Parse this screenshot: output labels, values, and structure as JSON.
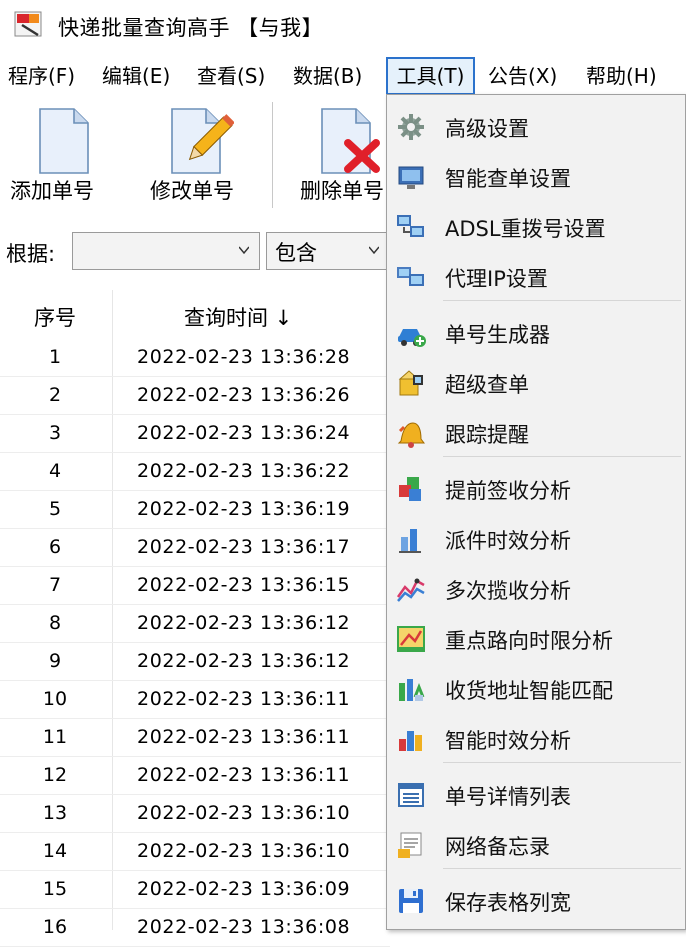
{
  "window": {
    "title": "快递批量查询高手 【与我】"
  },
  "menubar": {
    "items": [
      {
        "label": "程序(F)"
      },
      {
        "label": "编辑(E)"
      },
      {
        "label": "查看(S)"
      },
      {
        "label": "数据(B)"
      },
      {
        "label": "工具(T)"
      },
      {
        "label": "公告(X)"
      },
      {
        "label": "帮助(H)"
      }
    ]
  },
  "toolbar": {
    "add_label": "添加单号",
    "edit_label": "修改单号",
    "delete_label": "删除单号"
  },
  "filter": {
    "label": "根据:",
    "field_value": "",
    "mode_value": "包含"
  },
  "table": {
    "headers": {
      "index": "序号",
      "time": "查询时间 ↓"
    },
    "rows": [
      {
        "num": "1",
        "time": "2022-02-23 13:36:28"
      },
      {
        "num": "2",
        "time": "2022-02-23 13:36:26"
      },
      {
        "num": "3",
        "time": "2022-02-23 13:36:24"
      },
      {
        "num": "4",
        "time": "2022-02-23 13:36:22"
      },
      {
        "num": "5",
        "time": "2022-02-23 13:36:19"
      },
      {
        "num": "6",
        "time": "2022-02-23 13:36:17"
      },
      {
        "num": "7",
        "time": "2022-02-23 13:36:15"
      },
      {
        "num": "8",
        "time": "2022-02-23 13:36:12"
      },
      {
        "num": "9",
        "time": "2022-02-23 13:36:12"
      },
      {
        "num": "10",
        "time": "2022-02-23 13:36:11"
      },
      {
        "num": "11",
        "time": "2022-02-23 13:36:11"
      },
      {
        "num": "12",
        "time": "2022-02-23 13:36:11"
      },
      {
        "num": "13",
        "time": "2022-02-23 13:36:10"
      },
      {
        "num": "14",
        "time": "2022-02-23 13:36:10"
      },
      {
        "num": "15",
        "time": "2022-02-23 13:36:09"
      },
      {
        "num": "16",
        "time": "2022-02-23 13:36:08"
      }
    ]
  },
  "tools_menu": {
    "items": [
      {
        "label": "高级设置",
        "icon": "gear-icon"
      },
      {
        "label": "智能查单设置",
        "icon": "monitor-icon"
      },
      {
        "label": "ADSL重拨号设置",
        "icon": "network-icon"
      },
      {
        "label": "代理IP设置",
        "icon": "proxy-icon"
      },
      {
        "label": "单号生成器",
        "icon": "car-add-icon"
      },
      {
        "label": "超级查单",
        "icon": "super-query-icon"
      },
      {
        "label": "跟踪提醒",
        "icon": "bell-icon"
      },
      {
        "label": "提前签收分析",
        "icon": "cubes-icon"
      },
      {
        "label": "派件时效分析",
        "icon": "bar-chart-icon"
      },
      {
        "label": "多次揽收分析",
        "icon": "line-chart-icon"
      },
      {
        "label": "重点路向时限分析",
        "icon": "map-icon"
      },
      {
        "label": "收货地址智能匹配",
        "icon": "address-match-icon"
      },
      {
        "label": "智能时效分析",
        "icon": "column-chart-icon"
      },
      {
        "label": "单号详情列表",
        "icon": "list-icon"
      },
      {
        "label": "网络备忘录",
        "icon": "notepad-icon"
      },
      {
        "label": "保存表格列宽",
        "icon": "save-icon"
      }
    ]
  }
}
